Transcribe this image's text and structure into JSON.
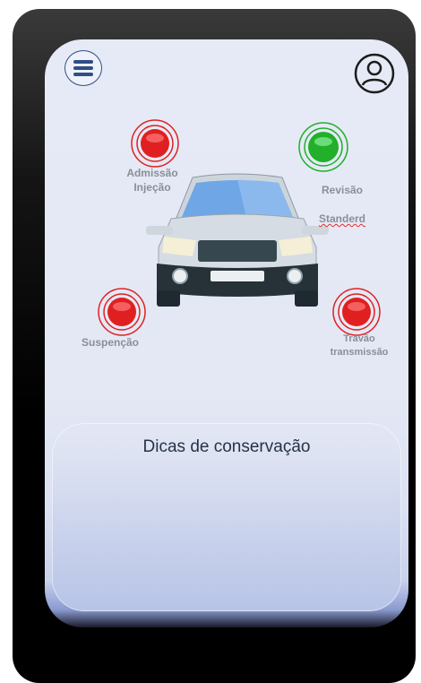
{
  "header": {
    "menu_icon": "hamburger-menu-icon",
    "profile_icon": "user-profile-icon"
  },
  "status_points": [
    {
      "id": "admissao",
      "label": "Admissão\nInjeção",
      "status_color": "#e02020"
    },
    {
      "id": "revisao",
      "label_line1": "Revisão",
      "label_line2": "Standerd",
      "status_color": "#22b02a"
    },
    {
      "id": "suspencao",
      "label": "Suspenção",
      "status_color": "#e02020"
    },
    {
      "id": "travao",
      "label": "Travão\ntransmissão",
      "status_color": "#e02020"
    }
  ],
  "tips": {
    "title": "Dicas de conservação"
  },
  "colors": {
    "alert": "#e02020",
    "ok": "#22b02a",
    "accent": "#2f4f86"
  }
}
